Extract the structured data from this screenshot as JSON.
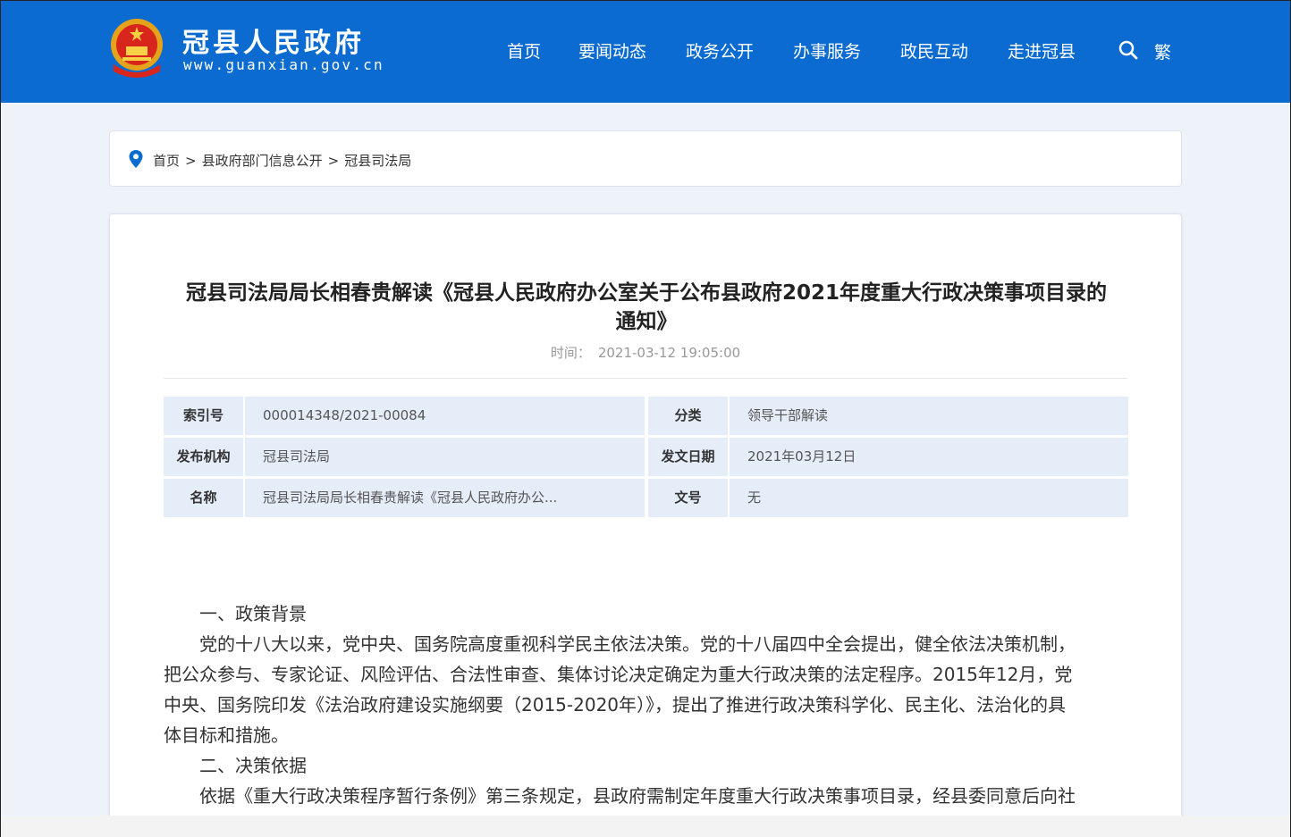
{
  "site": {
    "title": "冠县人民政府",
    "url": "www.guanxian.gov.cn"
  },
  "nav": {
    "items": [
      "首页",
      "要闻动态",
      "政务公开",
      "办事服务",
      "政民互动",
      "走进冠县"
    ],
    "search_icon": "search-icon",
    "traditional": "繁"
  },
  "breadcrumb": {
    "items": [
      "首页",
      "县政府部门信息公开",
      "冠县司法局"
    ],
    "separator": ">"
  },
  "article": {
    "title_line1": "冠县司法局局长相春贵解读《冠县人民政府办公室关于公布县政府2021年度重大行政决策事项目录的",
    "title_line2": "通知》",
    "time_label": "时间：",
    "time_value": "2021-03-12 19:05:00"
  },
  "meta": {
    "index_label": "索引号",
    "index_value": "000014348/2021-00084",
    "category_label": "分类",
    "category_value": "领导干部解读",
    "publisher_label": "发布机构",
    "publisher_value": "冠县司法局",
    "date_label": "发文日期",
    "date_value": "2021年03月12日",
    "name_label": "名称",
    "name_value": "冠县司法局局长相春贵解读《冠县人民政府办公...",
    "docno_label": "文号",
    "docno_value": "无"
  },
  "body": {
    "p1": "一、政策背景",
    "p2a": "党的十八大以来，党中央、国务院高度重视科学民主依法决策。党的十八届四中全会提出，健全依法决策机制，",
    "p2b": "把公众参与、专家论证、风险评估、合法性审查、集体讨论决定确定为重大行政决策的法定程序。2015年12月，党",
    "p2c": "中央、国务院印发《法治政府建设实施纲要（2015-2020年）》，提出了推进行政决策科学化、民主化、法治化的具",
    "p2d": "体目标和措施。",
    "p3": "二、决策依据",
    "p4a": "依据《重大行政决策程序暂行条例》第三条规定，县政府需制定年度重大行政决策事项目录，经县委同意后向社"
  },
  "colors": {
    "header_bg": "#0c6bd1",
    "page_bg": "#eef2f9",
    "meta_cell_bg": "#e5edf8"
  }
}
